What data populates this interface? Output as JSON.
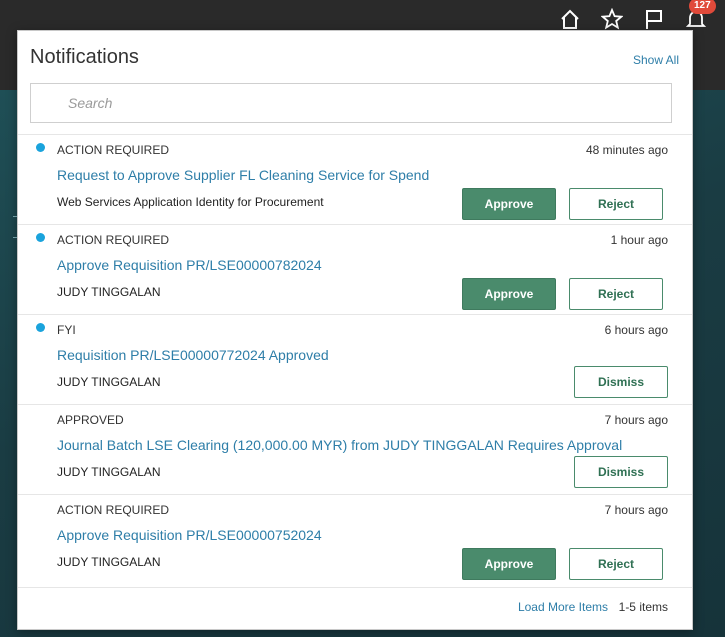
{
  "header": {
    "badge_count": "127",
    "icons": [
      "home-icon",
      "star-icon",
      "flag-icon",
      "bell-icon"
    ]
  },
  "notifications": {
    "title": "Notifications",
    "show_all": "Show All",
    "search": {
      "placeholder": "Search",
      "value": ""
    },
    "items": [
      {
        "unread": true,
        "status": "ACTION REQUIRED",
        "time": "48 minutes ago",
        "title": "Request to Approve Supplier FL Cleaning Service for Spend",
        "sender": "Web Services Application Identity for Procurement",
        "actions": [
          "Approve",
          "Reject"
        ]
      },
      {
        "unread": true,
        "status": "ACTION REQUIRED",
        "time": "1 hour ago",
        "title": "Approve Requisition PR/LSE00000782024",
        "sender": "JUDY TINGGALAN",
        "actions": [
          "Approve",
          "Reject"
        ]
      },
      {
        "unread": true,
        "status": "FYI",
        "time": "6 hours ago",
        "title": "Requisition PR/LSE00000772024 Approved",
        "sender": "JUDY TINGGALAN",
        "actions": [
          "Dismiss"
        ]
      },
      {
        "unread": false,
        "status": "APPROVED",
        "time": "7 hours ago",
        "title": "Journal Batch LSE Clearing (120,000.00 MYR) from JUDY TINGGALAN Requires Approval",
        "sender": "JUDY TINGGALAN",
        "actions": [
          "Dismiss"
        ]
      },
      {
        "unread": false,
        "status": "ACTION REQUIRED",
        "time": "7 hours ago",
        "title": "Approve Requisition PR/LSE00000752024",
        "sender": "JUDY TINGGALAN",
        "actions": [
          "Approve",
          "Reject"
        ]
      }
    ],
    "footer": {
      "load_more": "Load More Items",
      "count": "1-5 items"
    }
  },
  "colors": {
    "accent_link": "#2e7ea8",
    "approve_green": "#4a8b6c",
    "unread_dot": "#1aa3dc",
    "badge_red": "#e04a3a"
  }
}
